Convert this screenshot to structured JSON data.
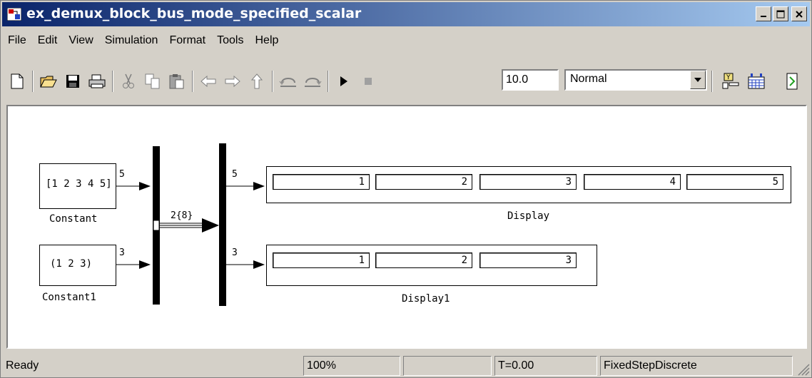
{
  "window": {
    "title": "ex_demux_block_bus_mode_specified_scalar"
  },
  "menu": [
    "File",
    "Edit",
    "View",
    "Simulation",
    "Format",
    "Tools",
    "Help"
  ],
  "toolbar": {
    "stop_time": "10.0",
    "sim_mode": "Normal"
  },
  "model": {
    "constant": {
      "value": "[1 2 3 4 5]",
      "label": "Constant",
      "out_width": "5"
    },
    "constant1": {
      "value": "(1  2  3)",
      "label": "Constant1",
      "out_width": "3"
    },
    "bus_label": "2{8}",
    "demux_out1_width": "5",
    "demux_out2_width": "3",
    "display": {
      "label": "Display",
      "values": [
        "1",
        "2",
        "3",
        "4",
        "5"
      ]
    },
    "display1": {
      "label": "Display1",
      "values": [
        "1",
        "2",
        "3"
      ]
    }
  },
  "status": {
    "state": "Ready",
    "zoom": "100%",
    "empty": "",
    "time": "T=0.00",
    "solver": "FixedStepDiscrete"
  }
}
